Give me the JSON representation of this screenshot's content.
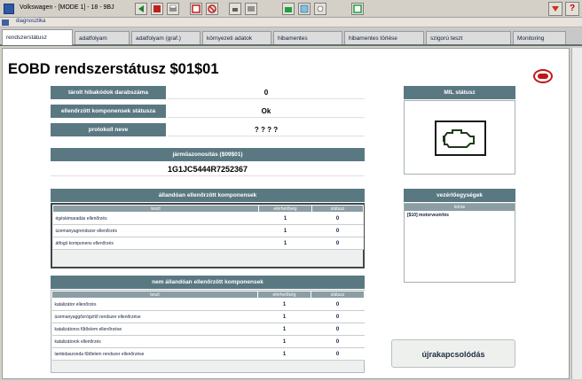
{
  "window": {
    "title": "Volkswagen - [MODE 1] - 18 - 9BJ",
    "close_label": "?"
  },
  "menu": {
    "label": "diagnosztika"
  },
  "tabs": [
    {
      "label": "rendszerstátusz",
      "active": true
    },
    {
      "label": "adatfolyam",
      "active": false
    },
    {
      "label": "adatfolyam (graf.)",
      "active": false
    },
    {
      "label": "környezeti adatok",
      "active": false
    },
    {
      "label": "hibamentes",
      "active": false
    },
    {
      "label": "hibamentes törlése",
      "active": false
    },
    {
      "label": "szigorú teszt",
      "active": false
    },
    {
      "label": "Monitoring",
      "active": false
    }
  ],
  "page": {
    "title": "EOBD rendszerstátusz  $01$01"
  },
  "status": {
    "rows": [
      {
        "label": "tárolt hibakódok darabszáma",
        "value": "0"
      },
      {
        "label": "ellenőrzött komponensek státusza",
        "value": "Ok"
      },
      {
        "label": "protokoll neve",
        "value": "? ? ? ?"
      }
    ]
  },
  "vin": {
    "label": "járműazonosítás  ($09$01)",
    "value": "1G1JC5444R7252367"
  },
  "continuous": {
    "title": "állandóan ellenőrzött komponensek",
    "columns": [
      "teszt",
      "elérhetőség",
      "státusz"
    ],
    "rows": [
      {
        "name": "égéskimaradás ellenőrzés",
        "a": "1",
        "b": "0"
      },
      {
        "name": "üzemanyagrendszer ellenőrzés",
        "a": "1",
        "b": "0"
      },
      {
        "name": "átfogó komponens ellenőrzés",
        "a": "1",
        "b": "0"
      }
    ]
  },
  "noncontinuous": {
    "title": "nem állandóan ellenőrzött komponensek",
    "columns": [
      "teszt",
      "elérhetőség",
      "státusz"
    ],
    "rows": [
      {
        "name": "katalizátor ellenőrzés",
        "a": "1",
        "b": "0"
      },
      {
        "name": "üzemanyaggőzrögzítő rendszer ellenőrzése",
        "a": "1",
        "b": "0"
      },
      {
        "name": "katalizátoros fűtőelem ellenőrzése",
        "a": "1",
        "b": "0"
      },
      {
        "name": "katalizátorok ellenőrzés",
        "a": "1",
        "b": "0"
      },
      {
        "name": "lambdaszonda fűtőelem rendszer ellenőrzése",
        "a": "1",
        "b": "0"
      }
    ]
  },
  "mil": {
    "title": "MIL státusz",
    "icon": "engine-check-icon",
    "color": "#1f3a1a"
  },
  "ecu": {
    "title": "vezérlőegységek",
    "column": "leírás",
    "items": [
      "[$10] motorvezérlés"
    ]
  },
  "reconnect": {
    "label": "újrakapcsolódás"
  },
  "colors": {
    "header": "#5a7882",
    "logo": "#c01818"
  }
}
